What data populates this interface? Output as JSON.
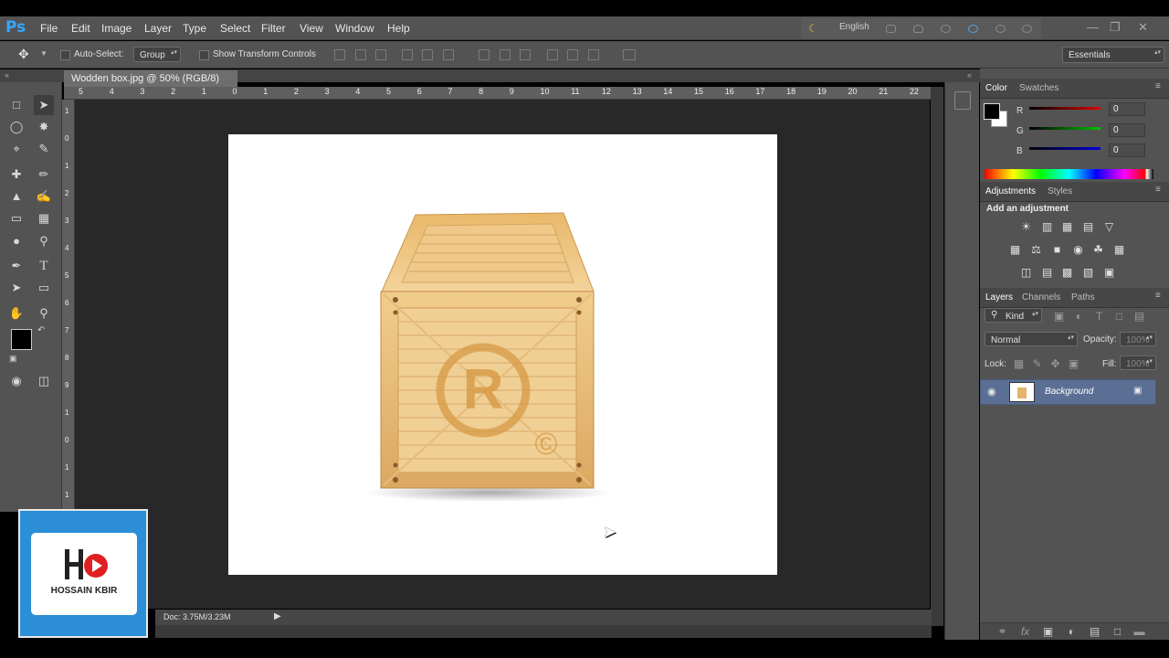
{
  "app": {
    "logo": "Ps"
  },
  "menu": [
    "File",
    "Edit",
    "Image",
    "Layer",
    "Type",
    "Select",
    "Filter",
    "View",
    "Window",
    "Help"
  ],
  "system": {
    "language": "English"
  },
  "options": {
    "auto_select_label": "Auto-Select:",
    "auto_select_value": "Group",
    "show_transform_label": "Show Transform Controls",
    "workspace": "Essentials"
  },
  "document": {
    "tab_title": "Wodden box.jpg @ 50% (RGB/8)",
    "tab_close": "×",
    "status": "Doc: 3.75M/3.23M"
  },
  "ruler": {
    "h_ticks": [
      "5",
      "4",
      "3",
      "2",
      "1",
      "0",
      "1",
      "2",
      "3",
      "4",
      "5",
      "6",
      "7",
      "8",
      "9",
      "10",
      "11",
      "12",
      "13",
      "14",
      "15",
      "16",
      "17",
      "18",
      "19",
      "20",
      "21",
      "22"
    ],
    "v_ticks": [
      "1",
      "0",
      "1",
      "2",
      "3",
      "4",
      "5",
      "6",
      "7",
      "8",
      "9",
      "1",
      "0",
      "1",
      "1"
    ]
  },
  "color_panel": {
    "tabs": [
      "Color",
      "Swatches"
    ],
    "channels": [
      {
        "label": "R",
        "value": "0",
        "color": "#e00000"
      },
      {
        "label": "G",
        "value": "0",
        "color": "#00c000"
      },
      {
        "label": "B",
        "value": "0",
        "color": "#0000e0"
      }
    ]
  },
  "adjustments_panel": {
    "tabs": [
      "Adjustments",
      "Styles"
    ],
    "heading": "Add an adjustment"
  },
  "layers_panel": {
    "tabs": [
      "Layers",
      "Channels",
      "Paths"
    ],
    "filter_kind": "Kind",
    "blend_mode": "Normal",
    "opacity_label": "Opacity:",
    "opacity_value": "100%",
    "lock_label": "Lock:",
    "fill_label": "Fill:",
    "fill_value": "100%",
    "layers": [
      {
        "name": "Background",
        "visible": true,
        "locked": true
      }
    ]
  },
  "watermark": {
    "brand": "HOSSAIN KBIR"
  },
  "crate": {
    "emblem": "R",
    "copyright": "©"
  }
}
